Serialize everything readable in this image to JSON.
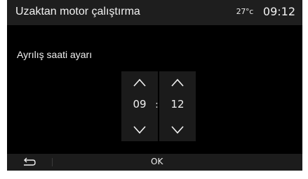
{
  "header": {
    "title": "Uzaktan motor çalıştırma",
    "temperature": "27°c",
    "time": "09:12"
  },
  "main": {
    "label": "Ayrılış saati ayarı",
    "hours": "09",
    "separator": ":",
    "minutes": "12"
  },
  "footer": {
    "back_icon": "back-arrow",
    "ok_label": "OK"
  },
  "colors": {
    "background": "#000000",
    "header_bar": "#1e1e1e",
    "spinner_bg": "#1b1b1b",
    "footer_bar": "#1c1c1c",
    "text": "#f0f0f0"
  }
}
